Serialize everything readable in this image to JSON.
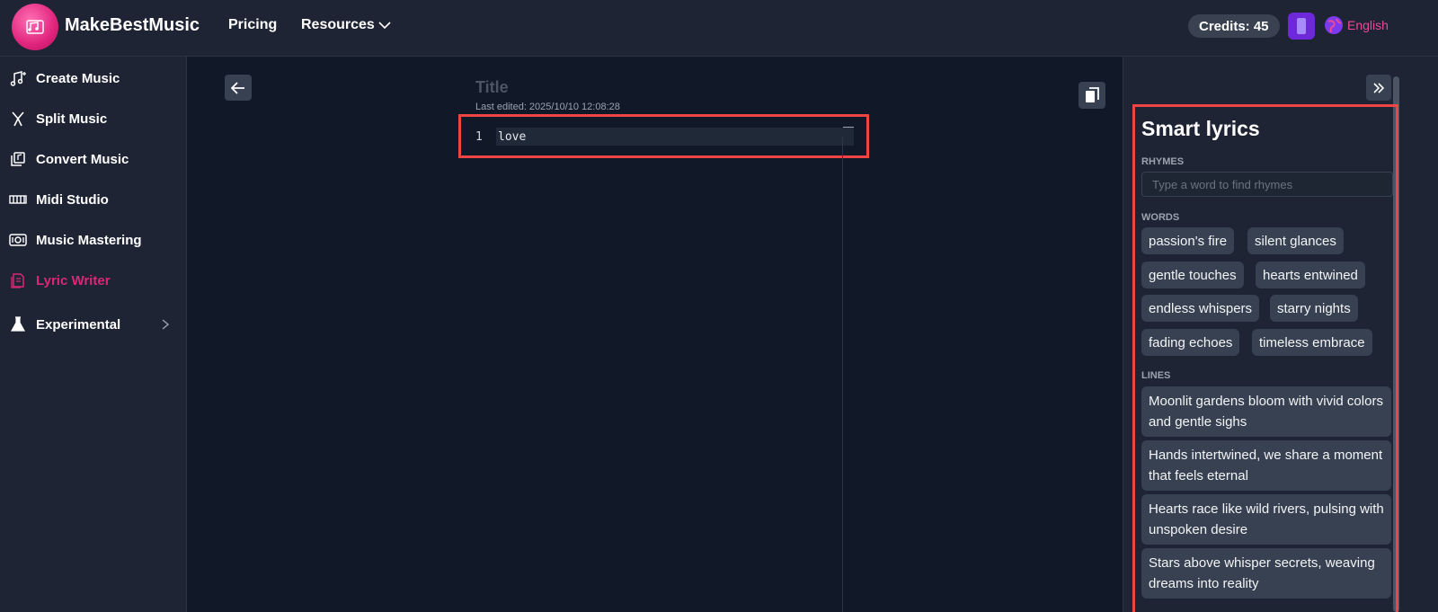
{
  "brand": {
    "name": "MakeBestMusic"
  },
  "nav": {
    "pricing": "Pricing",
    "resources": "Resources"
  },
  "header": {
    "credits": "Credits: 45",
    "language": "English"
  },
  "sidebar": {
    "items": [
      {
        "label": "Create Music",
        "icon": "music-note-plus-icon"
      },
      {
        "label": "Split Music",
        "icon": "split-icon"
      },
      {
        "label": "Convert Music",
        "icon": "convert-icon"
      },
      {
        "label": "Midi Studio",
        "icon": "midi-icon"
      },
      {
        "label": "Music Mastering",
        "icon": "mastering-icon"
      },
      {
        "label": "Lyric Writer",
        "icon": "lyric-icon"
      },
      {
        "label": "Experimental",
        "icon": "flask-icon"
      }
    ]
  },
  "editor": {
    "title_placeholder": "Title",
    "last_edited": "Last edited:  2025/10/10 12:08:28",
    "lines": [
      {
        "num": "1",
        "text": "love"
      }
    ]
  },
  "smart": {
    "title": "Smart lyrics",
    "rhymes_label": "RHYMES",
    "rhymes_placeholder": "Type a word to find rhymes",
    "words_label": "WORDS",
    "words": [
      "passion's fire",
      "silent glances",
      "gentle touches",
      "hearts entwined",
      "endless whispers",
      "starry nights",
      "fading echoes",
      "timeless embrace"
    ],
    "lines_label": "LINES",
    "lines": [
      "Moonlit gardens bloom with vivid colors and gentle sighs",
      "Hands intertwined, we share a moment that feels eternal",
      "Hearts race like wild rivers, pulsing with unspoken desire",
      "Stars above whisper secrets, weaving dreams into reality"
    ]
  },
  "colors": {
    "accent": "#db2777",
    "highlight": "#ef4444",
    "background": "#111827",
    "panel": "#1e2433"
  }
}
